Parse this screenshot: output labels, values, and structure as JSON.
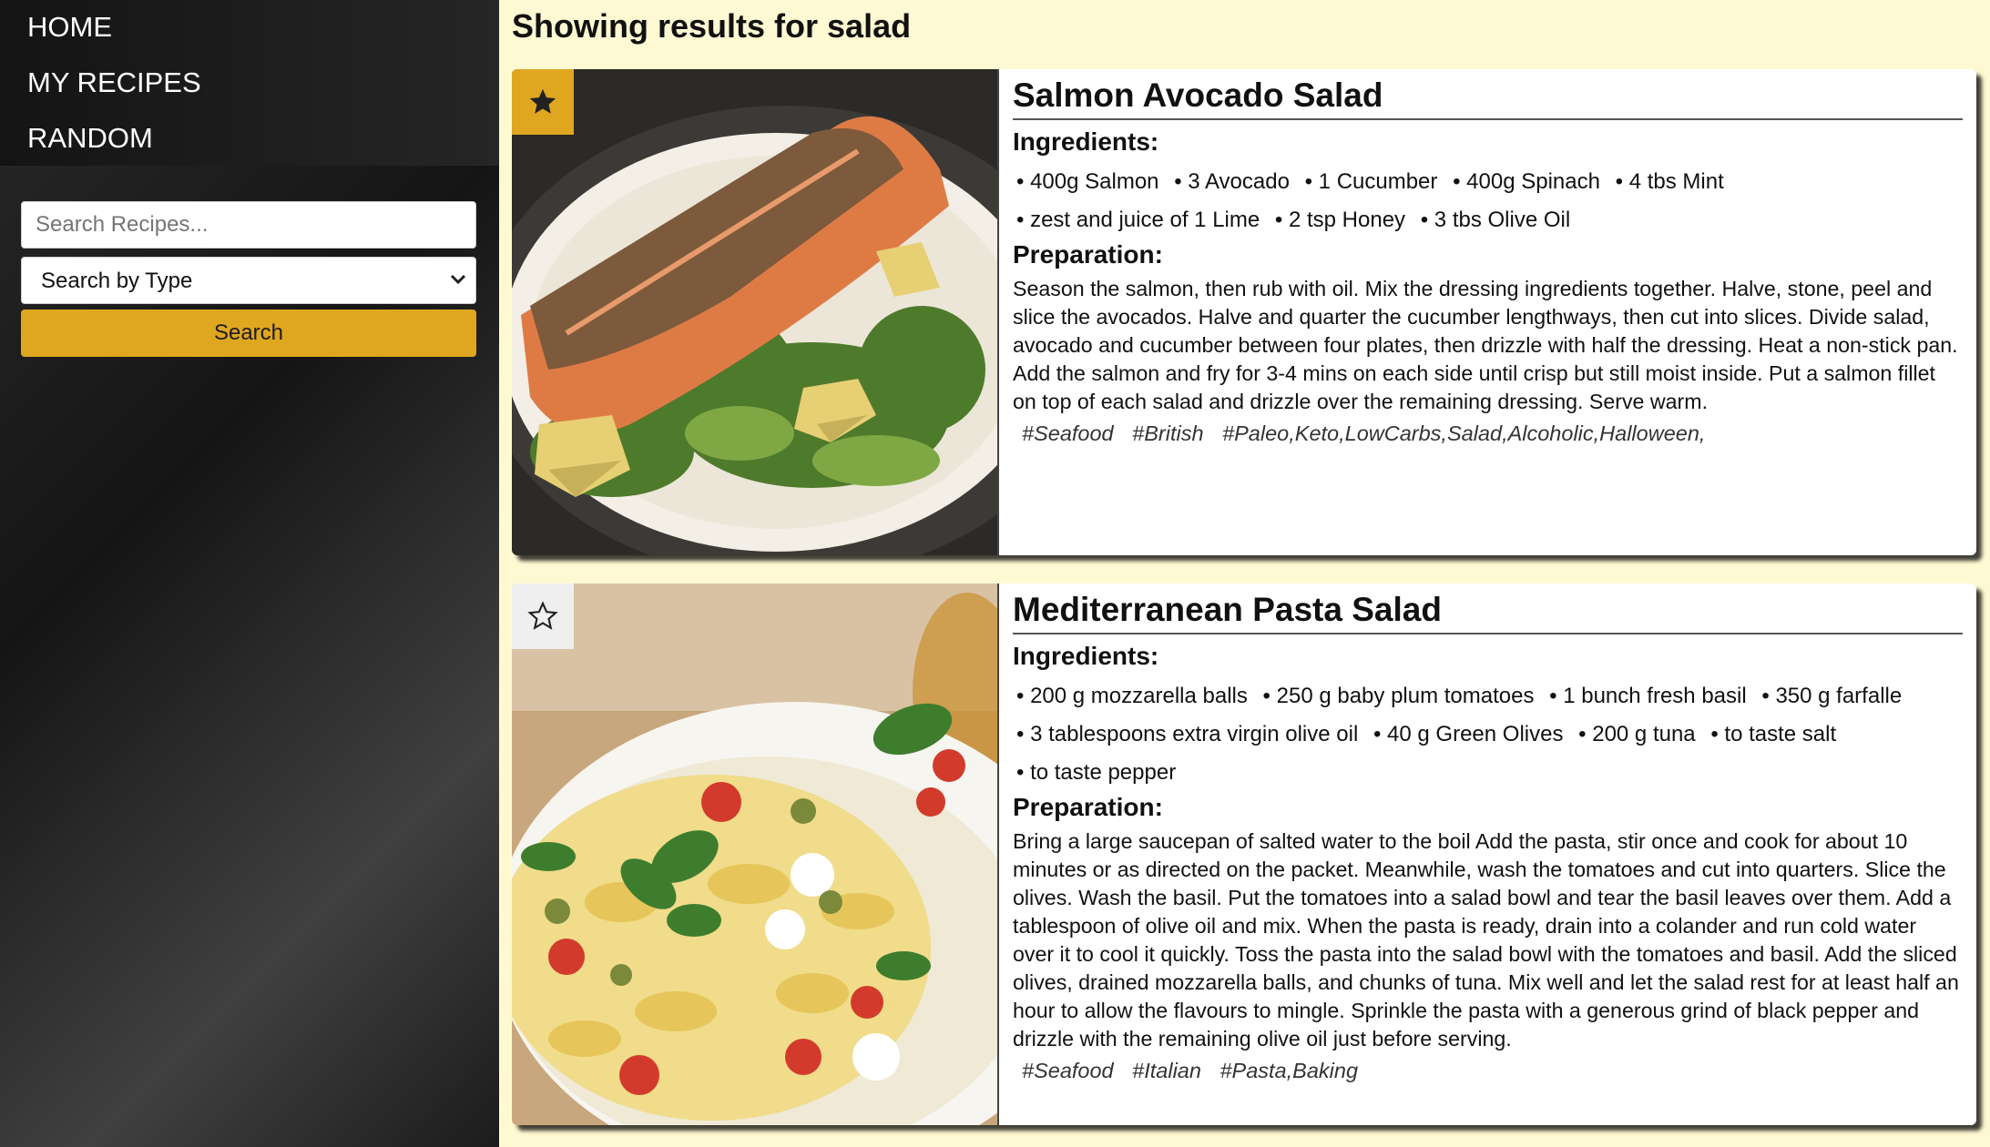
{
  "nav": {
    "items": [
      "HOME",
      "MY RECIPES",
      "RANDOM"
    ]
  },
  "search": {
    "placeholder": "Search Recipes...",
    "type_label": "Search by Type",
    "button_label": "Search"
  },
  "results": {
    "title": "Showing results for salad"
  },
  "cards": [
    {
      "title": "Salmon Avocado Salad",
      "favorited": true,
      "ingredients_label": "Ingredients:",
      "ingredient_rows": [
        [
          "400g Salmon",
          "3 Avocado",
          "1 Cucumber",
          "400g Spinach",
          "4 tbs Mint"
        ],
        [
          "zest and juice of 1 Lime",
          "2 tsp Honey",
          "3 tbs Olive Oil"
        ]
      ],
      "preparation_label": "Preparation:",
      "preparation": "Season the salmon, then rub with oil. Mix the dressing ingredients together. Halve, stone, peel and slice the avocados. Halve and quarter the cucumber lengthways, then cut into slices. Divide salad, avocado and cucumber between four plates, then drizzle with half the dressing. Heat a non-stick pan. Add the salmon and fry for 3-4 mins on each side until crisp but still moist inside. Put a salmon fillet on top of each salad and drizzle over the remaining dressing. Serve warm.",
      "tags": [
        "#Seafood",
        "#British",
        "#Paleo,Keto,LowCarbs,Salad,Alcoholic,Halloween,"
      ]
    },
    {
      "title": "Mediterranean Pasta Salad",
      "favorited": false,
      "ingredients_label": "Ingredients:",
      "ingredient_rows": [
        [
          "200 g mozzarella balls",
          "250 g baby plum tomatoes",
          "1 bunch fresh basil",
          "350 g farfalle"
        ],
        [
          "3 tablespoons extra virgin olive oil",
          "40 g Green Olives",
          "200 g tuna",
          "to taste salt"
        ],
        [
          "to taste pepper"
        ]
      ],
      "preparation_label": "Preparation:",
      "preparation": "Bring a large saucepan of salted water to the boil Add the pasta, stir once and cook for about 10 minutes or as directed on the packet. Meanwhile, wash the tomatoes and cut into quarters. Slice the olives. Wash the basil. Put the tomatoes into a salad bowl and tear the basil leaves over them. Add a tablespoon of olive oil and mix. When the pasta is ready, drain into a colander and run cold water over it to cool it quickly. Toss the pasta into the salad bowl with the tomatoes and basil. Add the sliced olives, drained mozzarella balls, and chunks of tuna. Mix well and let the salad rest for at least half an hour to allow the flavours to mingle. Sprinkle the pasta with a generous grind of black pepper and drizzle with the remaining olive oil just before serving.",
      "tags": [
        "#Seafood",
        "#Italian",
        "#Pasta,Baking"
      ]
    }
  ],
  "colors": {
    "accent": "#dfa61f",
    "page_bg": "#fef9d2",
    "sidebar_bg": "#1e1e1e"
  },
  "icons": {
    "favorite_filled": "star-filled-icon",
    "favorite_empty": "star-outline-icon",
    "select": "chevron-down-icon"
  }
}
